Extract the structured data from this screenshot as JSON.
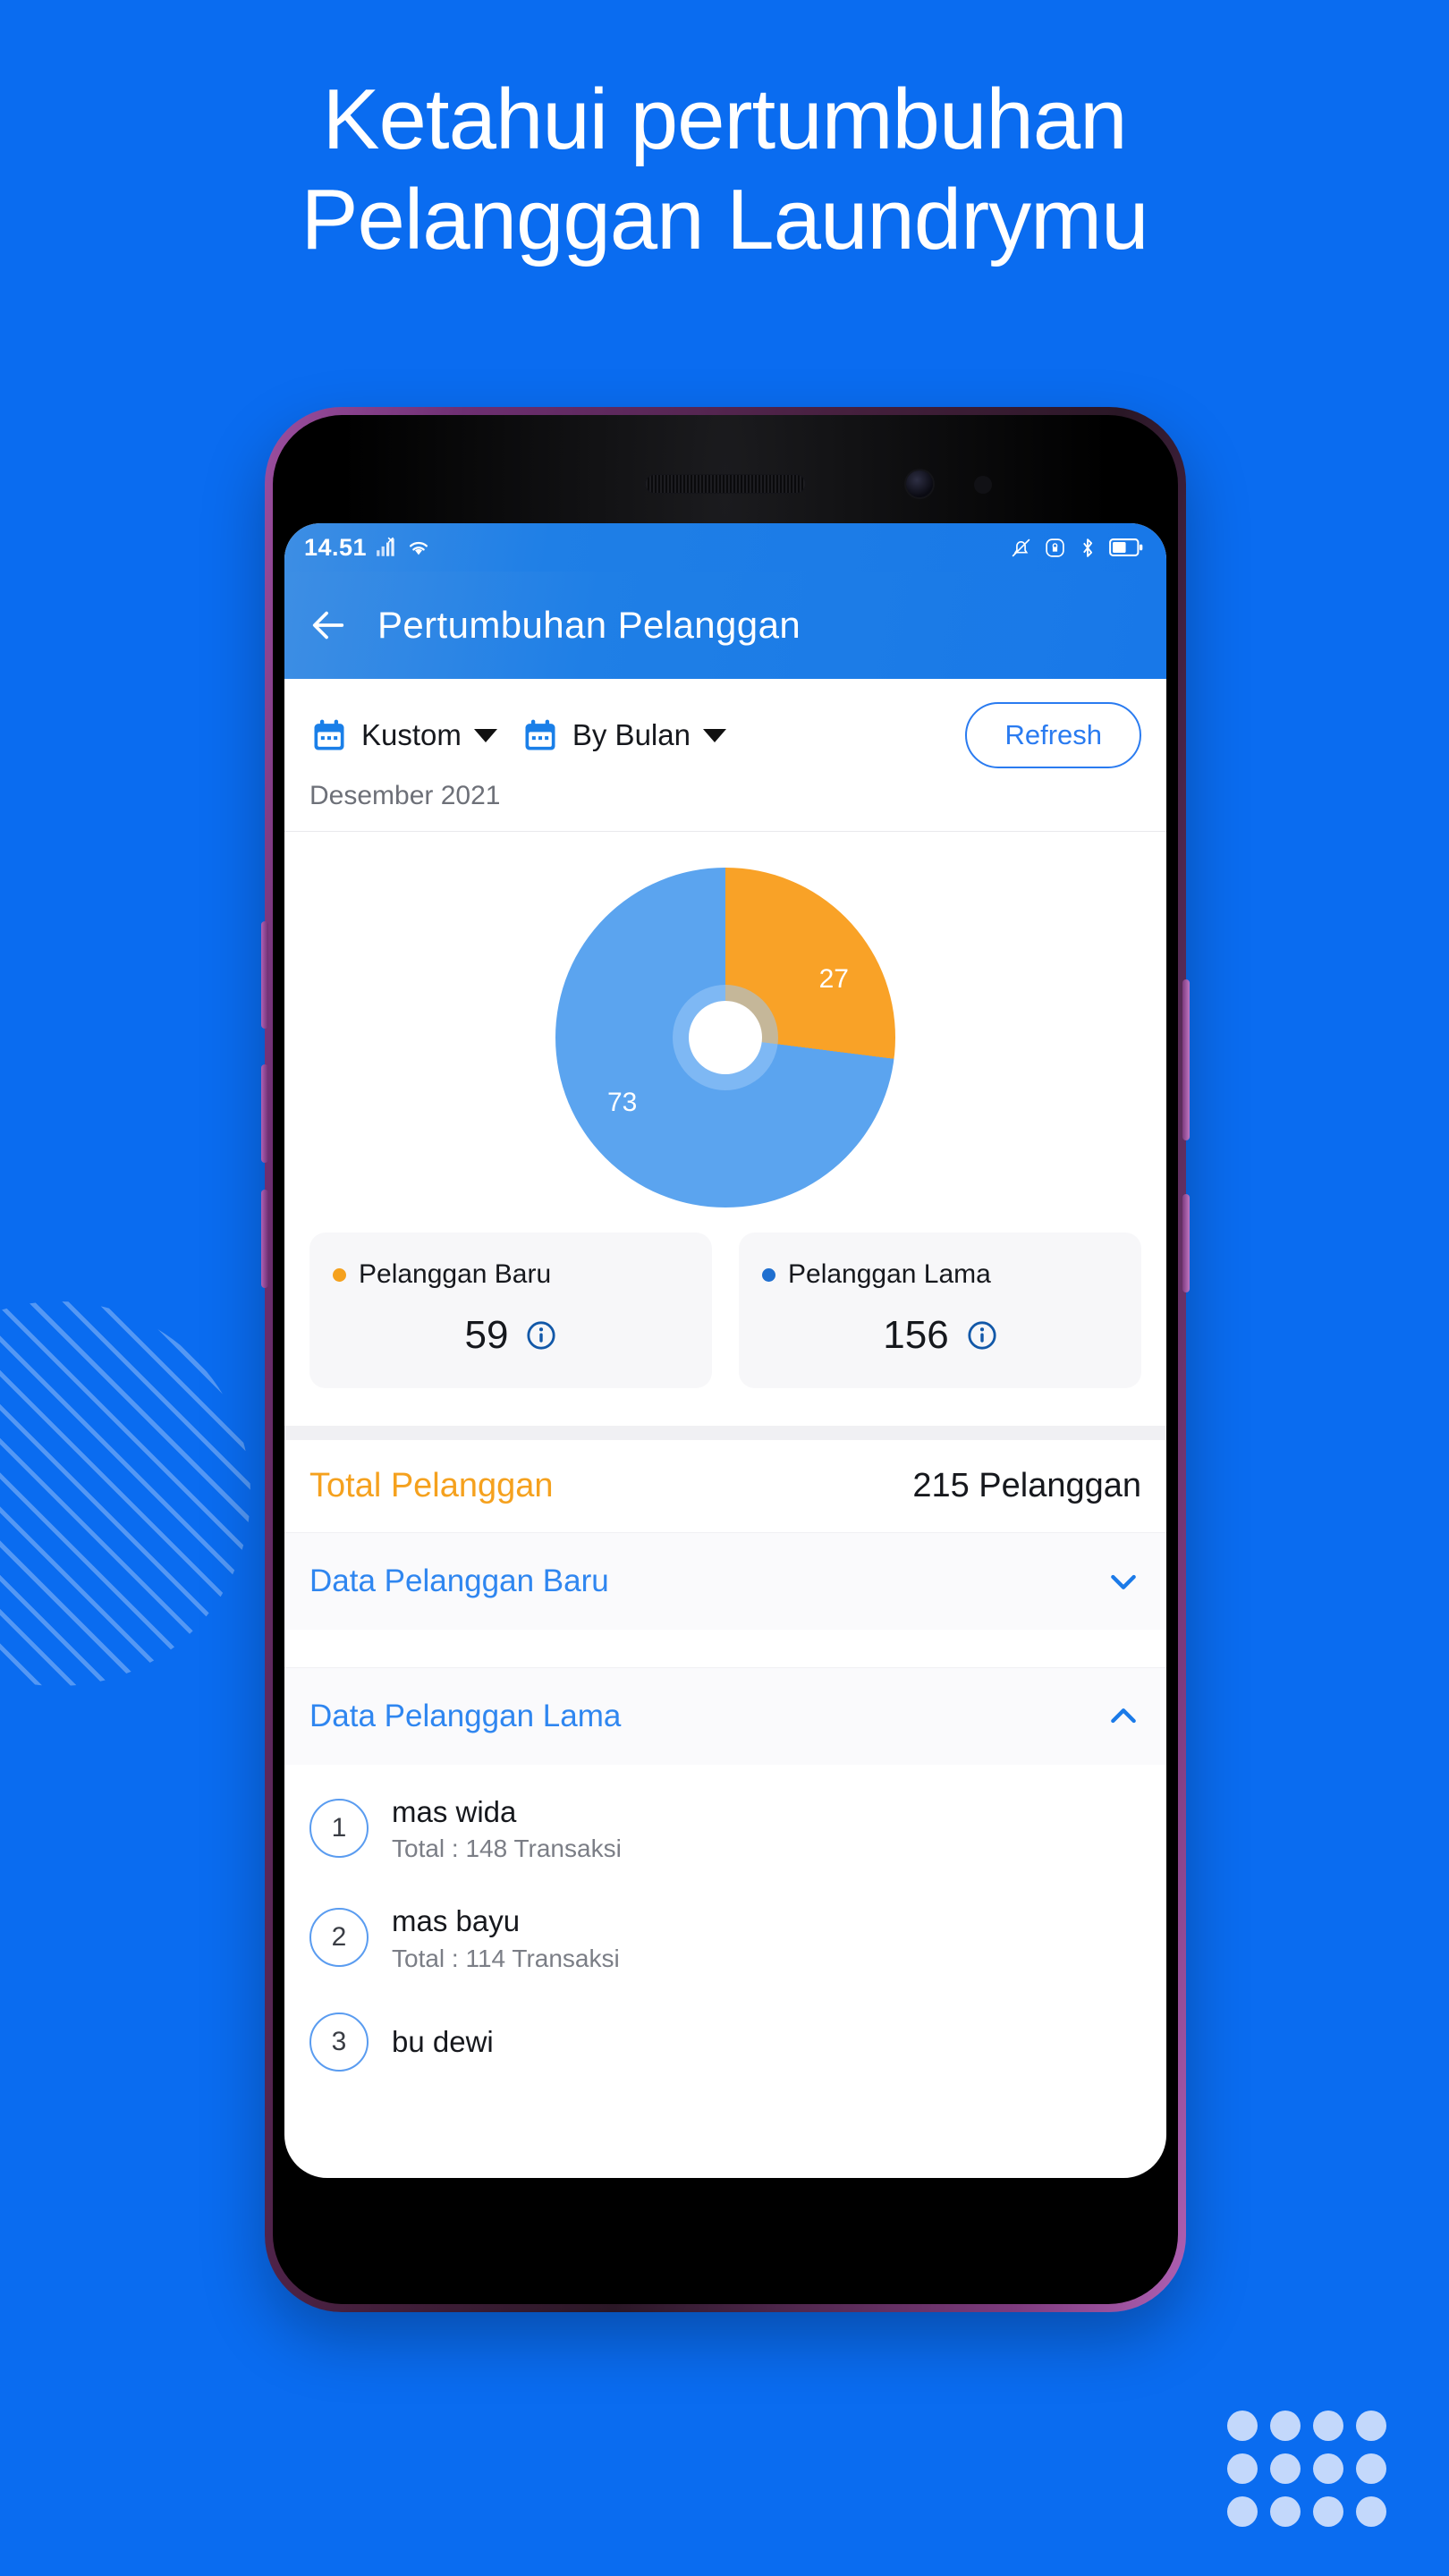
{
  "poster": {
    "background_color": "#0a6cf0",
    "headline_line1": "Ketahui pertumbuhan",
    "headline_line2": "Pelanggan Laundrymu"
  },
  "phone": {
    "status_bar": {
      "clock": "14.51",
      "icons_left": [
        "signal-icon",
        "wifi-icon"
      ],
      "icons_right": [
        "mute-icon",
        "rotation-lock-icon",
        "bluetooth-icon",
        "battery-icon"
      ]
    },
    "app_bar": {
      "back_icon": "back-arrow-icon",
      "title": "Pertumbuhan Pelanggan"
    },
    "filter_bar": {
      "range_chip": {
        "icon": "calendar-icon",
        "label": "Kustom",
        "caret": "chevron-down-icon"
      },
      "group_chip": {
        "icon": "calendar-icon",
        "label": "By Bulan",
        "caret": "chevron-down-icon"
      },
      "refresh_label": "Refresh",
      "period": "Desember 2021"
    },
    "chart_data": {
      "type": "pie",
      "title": "",
      "donut": true,
      "labels": [
        "Pelanggan Baru",
        "Pelanggan Lama"
      ],
      "values": [
        27,
        73
      ],
      "value_unit": "%",
      "data_labels": [
        "27",
        "73"
      ],
      "colors": [
        "#f9a227",
        "#5ba4ef"
      ],
      "start_angle_deg": 0,
      "legend": "below-chart-cards"
    },
    "stat_cards": [
      {
        "dot_color": "#f5a11e",
        "name": "Pelanggan Baru",
        "value": "59",
        "info_icon": "info-icon"
      },
      {
        "dot_color": "#1f6fd0",
        "name": "Pelanggan Lama",
        "value": "156",
        "info_icon": "info-icon"
      }
    ],
    "total": {
      "label": "Total Pelanggan",
      "value": "215 Pelanggan",
      "label_color": "#f5a11e"
    },
    "accordions": [
      {
        "label": "Data Pelanggan Baru",
        "state": "collapsed",
        "icon": "chevron-down-icon"
      },
      {
        "label": "Data Pelanggan Lama",
        "state": "expanded",
        "icon": "chevron-up-icon"
      }
    ],
    "customers": [
      {
        "rank": "1",
        "name": "mas wida",
        "sub": "Total : 148 Transaksi"
      },
      {
        "rank": "2",
        "name": "mas bayu",
        "sub": "Total : 114 Transaksi"
      },
      {
        "rank": "3",
        "name": "bu dewi",
        "sub": ""
      }
    ]
  }
}
